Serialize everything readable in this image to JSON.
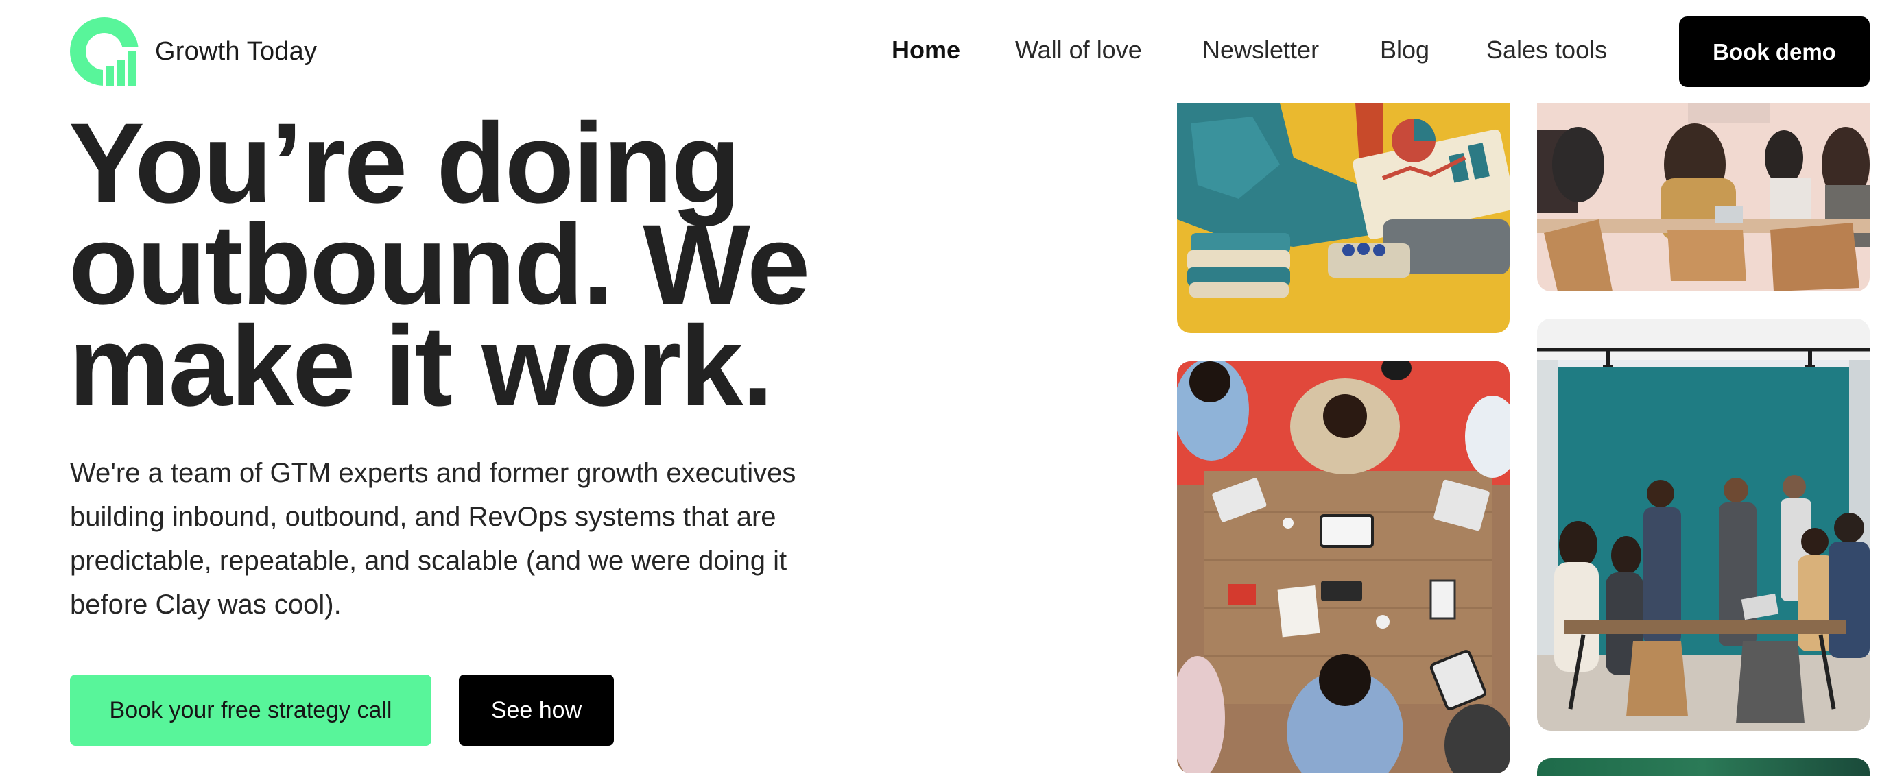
{
  "brand": {
    "name": "Growth Today",
    "accent": "#58f59a",
    "dark": "#000000"
  },
  "nav": {
    "links": [
      "Home",
      "Wall of love",
      "Newsletter",
      "Blog",
      "Sales tools"
    ],
    "active": "Home",
    "cta": "Book demo"
  },
  "hero": {
    "title_lines": [
      "You’re doing",
      "outbound. We",
      "make it work."
    ],
    "subtitle_lines": [
      "We're a team of GTM experts and former growth executives",
      "building inbound, outbound, and RevOps systems that are",
      "predictable, repeatable, and scalable (and we were doing it",
      "before Clay was cool)."
    ],
    "primary_cta": "Book your free strategy call",
    "secondary_cta": "See how"
  },
  "images": [
    {
      "subject": "clay-figure-with-chart-photo"
    },
    {
      "subject": "office-meeting-chairs-photo"
    },
    {
      "subject": "overhead-team-table-photo"
    },
    {
      "subject": "team-standing-meeting-photo"
    },
    {
      "subject": "green-photo-partial"
    }
  ]
}
